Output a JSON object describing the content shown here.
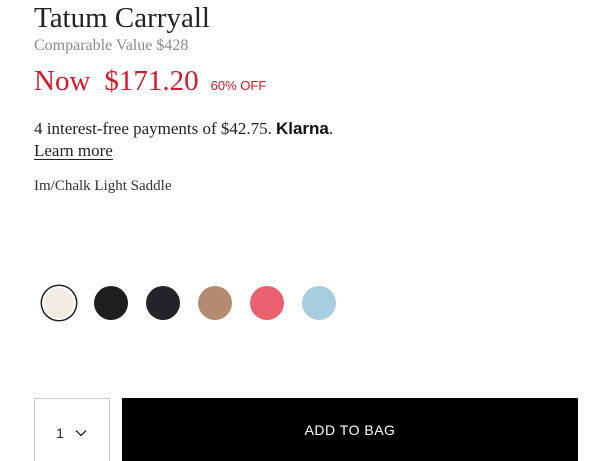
{
  "product": {
    "title": "Tatum Carryall",
    "comparable_label": "Comparable Value",
    "comparable_price": "$428",
    "now_label": "Now",
    "now_price": "$171.20",
    "discount": "60% OFF"
  },
  "payments": {
    "text": "4 interest-free payments of $42.75.",
    "provider": "Klarna",
    "provider_suffix": ".",
    "learn_more": "Learn more"
  },
  "selected_color": "Im/Chalk Light Saddle",
  "swatches": [
    {
      "name": "chalk",
      "color": "#f3ece3",
      "selected": true
    },
    {
      "name": "black",
      "color": "#1e1e1e",
      "selected": false
    },
    {
      "name": "navy",
      "color": "#22232b",
      "selected": false
    },
    {
      "name": "saddle",
      "color": "#b38b73",
      "selected": false
    },
    {
      "name": "pink",
      "color": "#e9606e",
      "selected": false
    },
    {
      "name": "light-blue",
      "color": "#a9cde0",
      "selected": false
    }
  ],
  "cart": {
    "quantity": "1",
    "add_label": "ADD TO BAG"
  },
  "colors": {
    "sale_red": "#d11a2a",
    "button_black": "#000000"
  }
}
